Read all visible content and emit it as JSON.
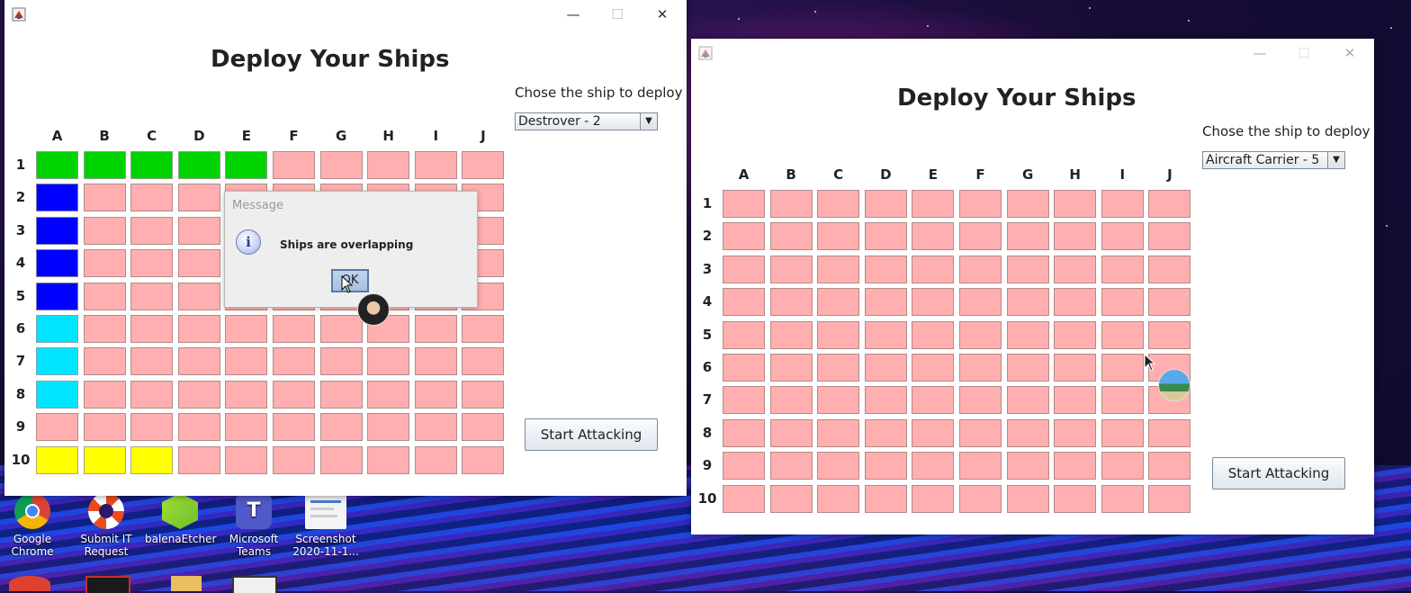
{
  "left_window": {
    "heading": "Deploy Your Ships",
    "chooser_label": "Chose the ship to deploy",
    "selected_ship": "Destrover - 2",
    "start_button": "Start Attacking",
    "dialog": {
      "title": "Message",
      "message": "Ships are overlapping",
      "ok_label": "OK"
    }
  },
  "right_window": {
    "heading": "Deploy Your Ships",
    "chooser_label": "Chose the ship to deploy",
    "selected_ship": "Aircraft Carrier - 5",
    "start_button": "Start Attacking"
  },
  "grid": {
    "columns": [
      "A",
      "B",
      "C",
      "D",
      "E",
      "F",
      "G",
      "H",
      "I",
      "J"
    ],
    "rows": [
      "1",
      "2",
      "3",
      "4",
      "5",
      "6",
      "7",
      "8",
      "9",
      "10"
    ]
  },
  "left_board_cells": [
    "green",
    "green",
    "green",
    "green",
    "green",
    "empty",
    "empty",
    "empty",
    "empty",
    "empty",
    "blue",
    "empty",
    "empty",
    "empty",
    "empty",
    "empty",
    "empty",
    "empty",
    "empty",
    "empty",
    "blue",
    "empty",
    "empty",
    "empty",
    "empty",
    "empty",
    "empty",
    "empty",
    "empty",
    "empty",
    "blue",
    "empty",
    "empty",
    "empty",
    "empty",
    "empty",
    "empty",
    "empty",
    "empty",
    "empty",
    "blue",
    "empty",
    "empty",
    "empty",
    "empty",
    "empty",
    "empty",
    "empty",
    "empty",
    "empty",
    "cyan",
    "empty",
    "empty",
    "empty",
    "empty",
    "empty",
    "empty",
    "empty",
    "empty",
    "empty",
    "cyan",
    "empty",
    "empty",
    "empty",
    "empty",
    "empty",
    "empty",
    "empty",
    "empty",
    "empty",
    "cyan",
    "empty",
    "empty",
    "empty",
    "empty",
    "empty",
    "empty",
    "empty",
    "empty",
    "empty",
    "empty",
    "empty",
    "empty",
    "empty",
    "empty",
    "empty",
    "empty",
    "empty",
    "empty",
    "empty",
    "yellow",
    "yellow",
    "yellow",
    "empty",
    "empty",
    "empty",
    "empty",
    "empty",
    "empty",
    "empty"
  ],
  "colors": {
    "empty": "#ffafaf",
    "green": "#00d400",
    "blue": "#0000ff",
    "cyan": "#00e5ff",
    "yellow": "#ffff00"
  },
  "desktop_icons": [
    {
      "label_line1": "Google",
      "label_line2": "Chrome",
      "icon": "chrome-icon"
    },
    {
      "label_line1": "Submit IT",
      "label_line2": "Request",
      "icon": "lifebuoy-icon"
    },
    {
      "label_line1": "balenaEtcher",
      "label_line2": "",
      "icon": "etcher-icon"
    },
    {
      "label_line1": "Microsoft",
      "label_line2": "Teams",
      "icon": "teams-icon"
    },
    {
      "label_line1": "Screenshot",
      "label_line2": "2020-11-1...",
      "icon": "screenshot-file-icon"
    }
  ]
}
